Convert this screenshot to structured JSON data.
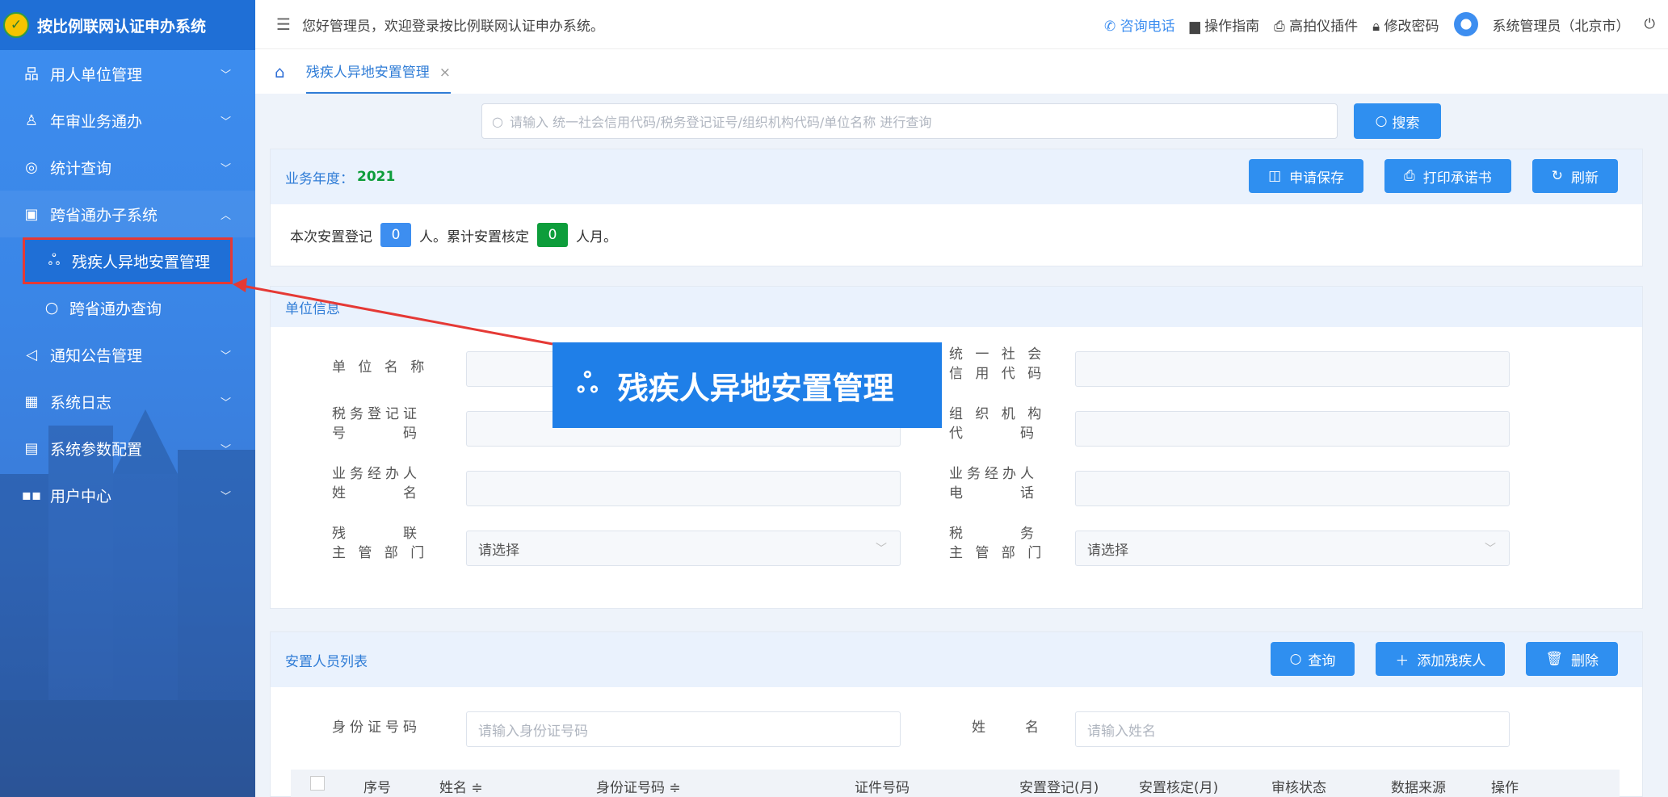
{
  "app": {
    "title": "按比例联网认证申办系统"
  },
  "sidebar": {
    "items": [
      {
        "icon": "org-icon",
        "label": "用人单位管理"
      },
      {
        "icon": "user-icon",
        "label": "年审业务通办"
      },
      {
        "icon": "stats-icon",
        "label": "统计查询"
      },
      {
        "icon": "subsystem-icon",
        "label": "跨省通办子系统"
      },
      {
        "icon": "notice-icon",
        "label": "通知公告管理"
      },
      {
        "icon": "log-icon",
        "label": "系统日志"
      },
      {
        "icon": "config-icon",
        "label": "系统参数配置"
      },
      {
        "icon": "grid-icon",
        "label": "用户中心"
      }
    ],
    "subitems": [
      {
        "icon": "people-icon",
        "label": "残疾人异地安置管理"
      },
      {
        "icon": "search-icon",
        "label": "跨省通办查询"
      }
    ]
  },
  "header": {
    "welcome": "您好管理员，欢迎登录按比例联网认证申办系统。",
    "consult": "咨询电话",
    "guide": "操作指南",
    "plugin": "高拍仪插件",
    "password": "修改密码",
    "user": "系统管理员（北京市）"
  },
  "tabs": [
    {
      "label": "残疾人异地安置管理"
    }
  ],
  "search": {
    "placeholder": "请输入 统一社会信用代码/税务登记证号/组织机构代码/单位名称 进行查询",
    "button": "搜索"
  },
  "year_panel": {
    "label": "业务年度：",
    "year": "2021",
    "apply_save": "申请保存",
    "print": "打印承诺书",
    "refresh": "刷新"
  },
  "stats": {
    "prefix": "本次安置登记",
    "count1": "0",
    "mid": "人。累计安置核定",
    "count2": "0",
    "suffix": "人月。"
  },
  "unit_info": {
    "title": "单位信息",
    "fields": {
      "name": "单 位 名 称",
      "credit_a": "统 一 社 会",
      "credit_b": "信 用 代 码",
      "tax_a": "税务登记证",
      "tax_b": "号　　　码",
      "org_a": "组 织 机 构",
      "org_b": "代　　　码",
      "handler_a": "业务经办人",
      "handler_b": "姓　　　名",
      "phone_a": "业务经办人",
      "phone_b": "电　　　话",
      "dept_a": "残　　　联",
      "dept_b": "主 管 部 门",
      "taxdept_a": "税　　　务",
      "taxdept_b": "主 管 部 门"
    },
    "select_placeholder": "请选择"
  },
  "personnel": {
    "title": "安置人员列表",
    "query": "查询",
    "add": "添加残疾人",
    "delete": "删除",
    "id_label": "身份证号码",
    "id_placeholder": "请输入身份证号码",
    "name_label": "姓　　名",
    "name_placeholder": "请输入姓名",
    "columns": [
      "序号",
      "姓名 ≑",
      "身份证号码 ≑",
      "证件号码",
      "安置登记(月)",
      "安置核定(月)",
      "审核状态",
      "数据来源",
      "操作"
    ]
  },
  "callout": {
    "label": "残疾人异地安置管理"
  },
  "colors": {
    "primary": "#2f8ff0",
    "green": "#0d9d3b",
    "highlight": "#e53935"
  }
}
